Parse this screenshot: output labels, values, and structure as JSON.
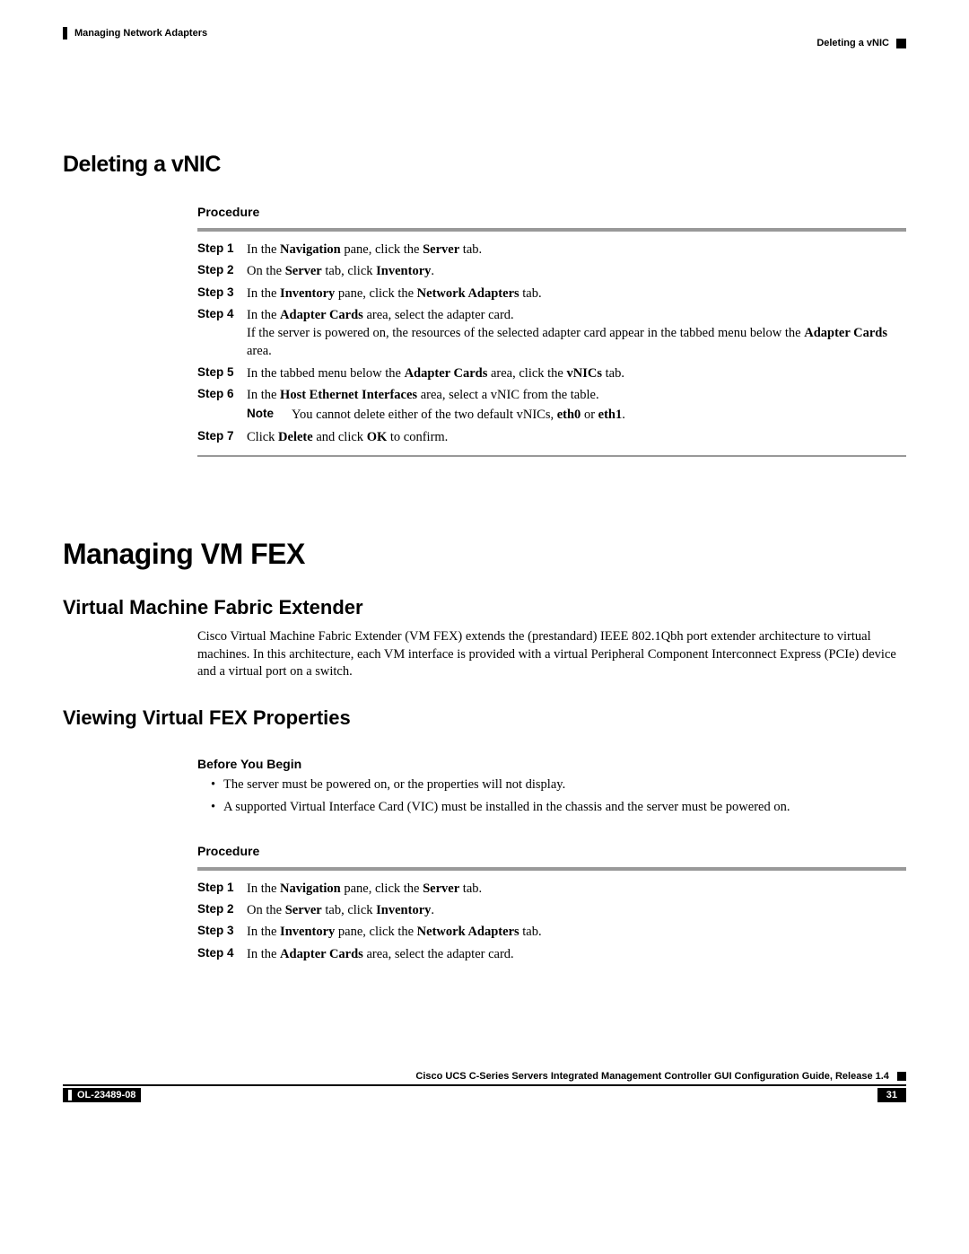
{
  "header": {
    "chapter": "Managing Network Adapters",
    "topic": "Deleting a vNIC"
  },
  "section1": {
    "title": "Deleting a vNIC",
    "procedure_label": "Procedure",
    "steps": [
      {
        "label": "Step 1",
        "pre": "In the ",
        "b1": "Navigation",
        "mid": " pane, click the ",
        "b2": "Server",
        "post": " tab."
      },
      {
        "label": "Step 2",
        "pre": "On the ",
        "b1": "Server",
        "mid": " tab, click ",
        "b2": "Inventory",
        "post": "."
      },
      {
        "label": "Step 3",
        "pre": "In the ",
        "b1": "Inventory",
        "mid": " pane, click the ",
        "b2": "Network Adapters",
        "post": " tab."
      },
      {
        "label": "Step 4",
        "line1_pre": "In the ",
        "line1_b": "Adapter Cards",
        "line1_post": " area, select the adapter card.",
        "line2_pre": "If the server is powered on, the resources of the selected adapter card appear in the tabbed menu below the ",
        "line2_b": "Adapter Cards",
        "line2_post": " area."
      },
      {
        "label": "Step 5",
        "pre": "In the tabbed menu below the ",
        "b1": "Adapter Cards",
        "mid": " area, click the ",
        "b2": "vNICs",
        "post": " tab."
      },
      {
        "label": "Step 6",
        "line1_pre": "In the ",
        "line1_b": "Host Ethernet Interfaces",
        "line1_post": " area, select a vNIC from the table.",
        "note_label": "Note",
        "note_pre": "You cannot delete either of the two default vNICs, ",
        "note_b1": "eth0",
        "note_mid": " or ",
        "note_b2": "eth1",
        "note_post": "."
      },
      {
        "label": "Step 7",
        "pre": "Click ",
        "b1": "Delete",
        "mid": " and click ",
        "b2": "OK",
        "post": " to confirm."
      }
    ]
  },
  "section2": {
    "title": "Managing VM FEX",
    "sub1_title": "Virtual Machine Fabric Extender",
    "sub1_para": "Cisco Virtual Machine Fabric Extender (VM FEX) extends the (prestandard) IEEE 802.1Qbh port extender architecture to virtual machines. In this architecture, each VM interface is provided with a virtual Peripheral Component Interconnect Express (PCIe) device and a virtual port on a switch.",
    "sub2_title": "Viewing Virtual FEX Properties",
    "before_label": "Before You Begin",
    "before_bullets": [
      "The server must be powered on, or the properties will not display.",
      "A supported Virtual Interface Card (VIC) must be installed in the chassis and the server must be powered on."
    ],
    "procedure_label": "Procedure",
    "steps": [
      {
        "label": "Step 1",
        "pre": "In the ",
        "b1": "Navigation",
        "mid": " pane, click the ",
        "b2": "Server",
        "post": " tab."
      },
      {
        "label": "Step 2",
        "pre": "On the ",
        "b1": "Server",
        "mid": " tab, click ",
        "b2": "Inventory",
        "post": "."
      },
      {
        "label": "Step 3",
        "pre": "In the ",
        "b1": "Inventory",
        "mid": " pane, click the ",
        "b2": "Network Adapters",
        "post": " tab."
      },
      {
        "label": "Step 4",
        "pre": "In the ",
        "b1": "Adapter Cards",
        "mid": " area, select the adapter card.",
        "b2": "",
        "post": ""
      }
    ]
  },
  "footer": {
    "doc_title": "Cisco UCS C-Series Servers Integrated Management Controller GUI Configuration Guide, Release 1.4",
    "doc_id": "OL-23489-08",
    "page_num": "31"
  }
}
